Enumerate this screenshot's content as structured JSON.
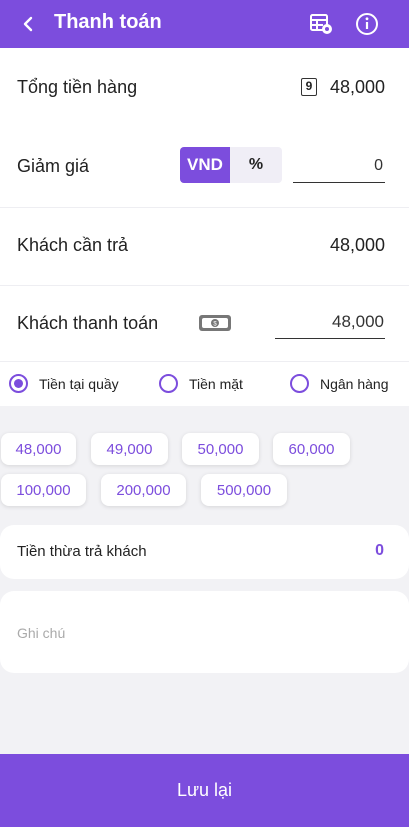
{
  "header": {
    "title": "Thanh toán",
    "back_icon": "chevron-left-icon",
    "table_icon": "table-view-icon",
    "info_icon": "info-icon"
  },
  "total": {
    "label": "Tổng tiền hàng",
    "count": "9",
    "value": "48,000"
  },
  "discount": {
    "label": "Giảm giá",
    "mode_vnd": "VND",
    "mode_percent": "%",
    "value": "0"
  },
  "due": {
    "label": "Khách cần trả",
    "value": "48,000"
  },
  "paid": {
    "label": "Khách thanh toán",
    "icon": "cash-icon",
    "value": "48,000"
  },
  "payment_methods": [
    {
      "label": "Tiền tại quầy",
      "selected": true
    },
    {
      "label": "Tiền mặt",
      "selected": false
    },
    {
      "label": "Ngân hàng",
      "selected": false
    }
  ],
  "quick_amounts": [
    "48,000",
    "49,000",
    "50,000",
    "60,000",
    "100,000",
    "200,000",
    "500,000"
  ],
  "change": {
    "label": "Tiền thừa trả khách",
    "value": "0"
  },
  "note": {
    "placeholder": "Ghi chú"
  },
  "save_label": "Lưu lại",
  "colors": {
    "accent": "#7c4ddd",
    "background": "#f2f2f5"
  }
}
